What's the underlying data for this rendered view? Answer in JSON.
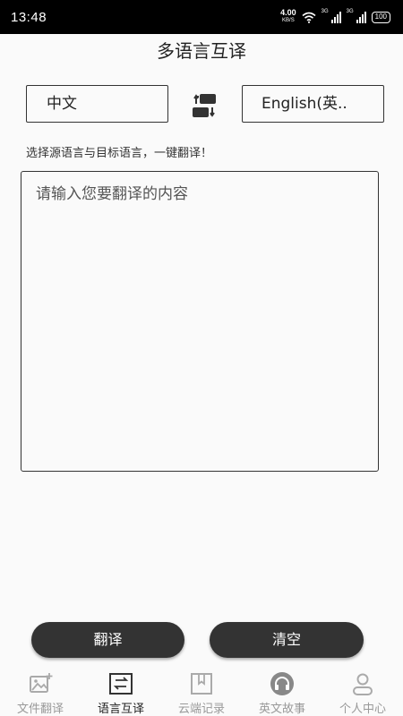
{
  "status_bar": {
    "time": "13:48",
    "net_speed_value": "4.00",
    "net_speed_unit": "KB/S",
    "signal1_tag": "3G",
    "signal2_tag": "3G",
    "battery": "100",
    "icons": [
      "wifi-icon",
      "signal-icon",
      "signal-icon",
      "battery-icon"
    ]
  },
  "header": {
    "title": "多语言互译"
  },
  "languages": {
    "source": "中文",
    "target": "English(英..",
    "swap_icon": "swap-icon"
  },
  "hint": "选择源语言与目标语言，一键翻译！",
  "input": {
    "placeholder": "请输入您要翻译的内容",
    "value": ""
  },
  "actions": {
    "translate": "翻译",
    "clear": "清空"
  },
  "nav": {
    "items": [
      {
        "label": "文件翻译",
        "icon": "image-add-icon",
        "active": false
      },
      {
        "label": "语言互译",
        "icon": "translate-icon",
        "active": true
      },
      {
        "label": "云端记录",
        "icon": "bookmark-icon",
        "active": false
      },
      {
        "label": "英文故事",
        "icon": "headphones-icon",
        "active": false
      },
      {
        "label": "个人中心",
        "icon": "person-icon",
        "active": false
      }
    ]
  },
  "colors": {
    "status_bg": "#000000",
    "button_bg": "#333333",
    "background": "#fafafa",
    "inactive_text": "#999999"
  }
}
